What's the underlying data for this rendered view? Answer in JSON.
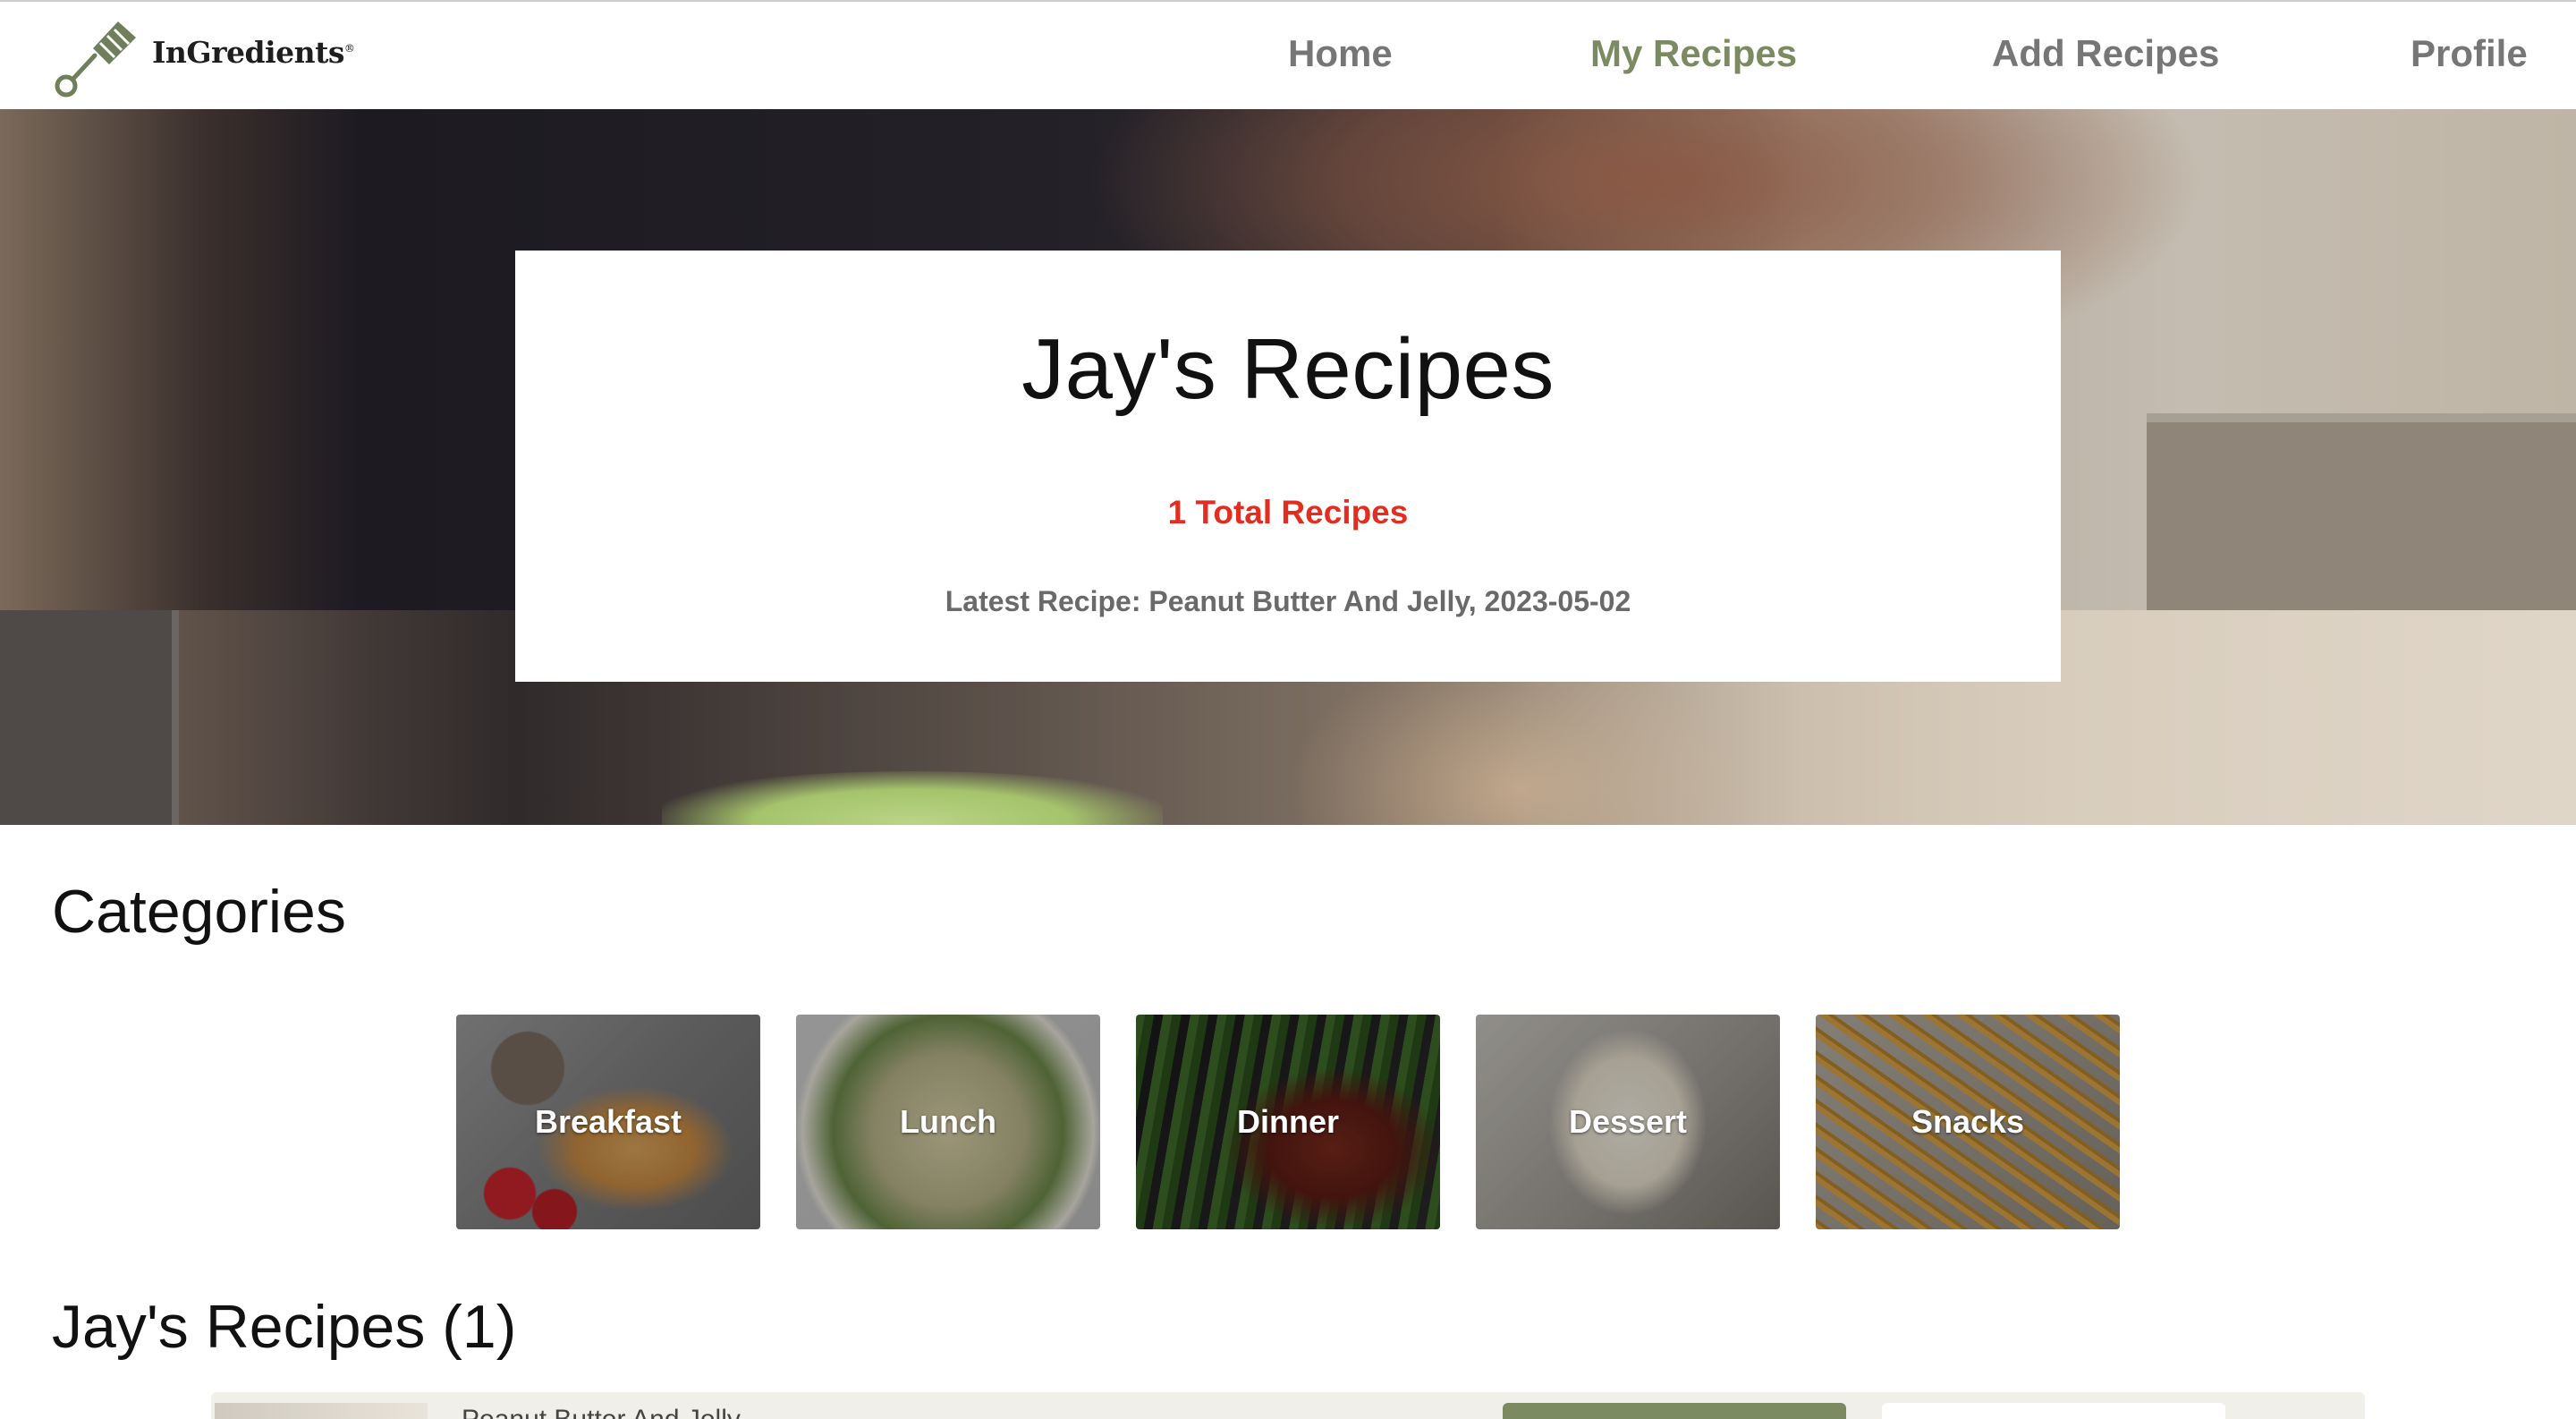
{
  "brand": {
    "name": "InGredients",
    "mark": "®",
    "icon": "spatula-icon",
    "color": "#7c8a62"
  },
  "nav": {
    "items": [
      {
        "label": "Home",
        "active": false
      },
      {
        "label": "My Recipes",
        "active": true
      },
      {
        "label": "Add Recipes",
        "active": false
      },
      {
        "label": "Profile",
        "active": false
      }
    ],
    "active_color": "#7c8a62"
  },
  "hero": {
    "title": "Jay's Recipes",
    "total": "1 Total Recipes",
    "latest": "Latest Recipe: Peanut Butter And Jelly, 2023-05-02",
    "total_color": "#e22d20"
  },
  "categories": {
    "heading": "Categories",
    "items": [
      {
        "label": "Breakfast"
      },
      {
        "label": "Lunch"
      },
      {
        "label": "Dinner"
      },
      {
        "label": "Dessert"
      },
      {
        "label": "Snacks"
      }
    ]
  },
  "recipes": {
    "heading": "Jay's Recipes (1)",
    "items": [
      {
        "name": "Peanut Butter And Jelly"
      }
    ]
  }
}
